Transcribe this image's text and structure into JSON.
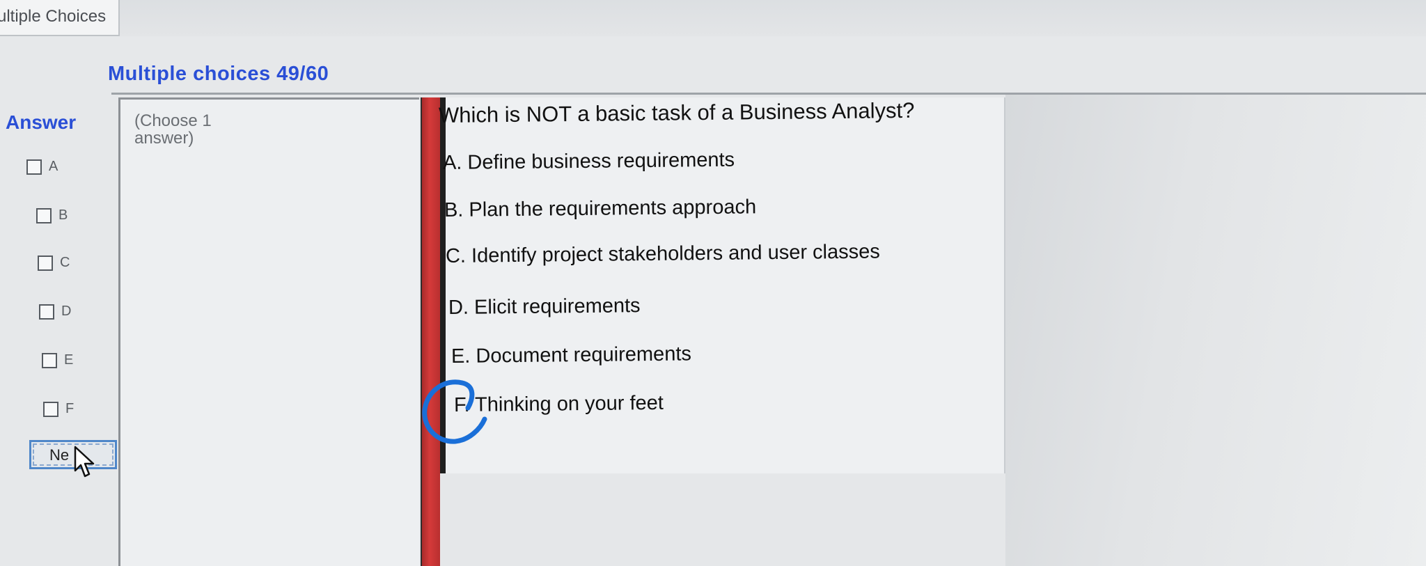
{
  "window": {
    "tab_title": "ultiple Choices"
  },
  "header": {
    "title": "Multiple choices 49/60"
  },
  "answer_panel": {
    "heading": "Answer",
    "choices": [
      "A",
      "B",
      "C",
      "D",
      "E",
      "F"
    ],
    "next_label": "Ne"
  },
  "instruction": {
    "text": "(Choose 1 answer)"
  },
  "question": {
    "text": "Which is NOT a basic task of a Business Analyst?",
    "options": [
      "A. Define business requirements",
      "B. Plan the requirements approach",
      "C. Identify project stakeholders and user classes",
      "D. Elicit requirements",
      "E. Document requirements",
      "F. Thinking on your feet"
    ]
  },
  "colors": {
    "accent_blue": "#2a4fd6",
    "red_divider": "#c93333",
    "marker_blue": "#1a6fd8"
  }
}
